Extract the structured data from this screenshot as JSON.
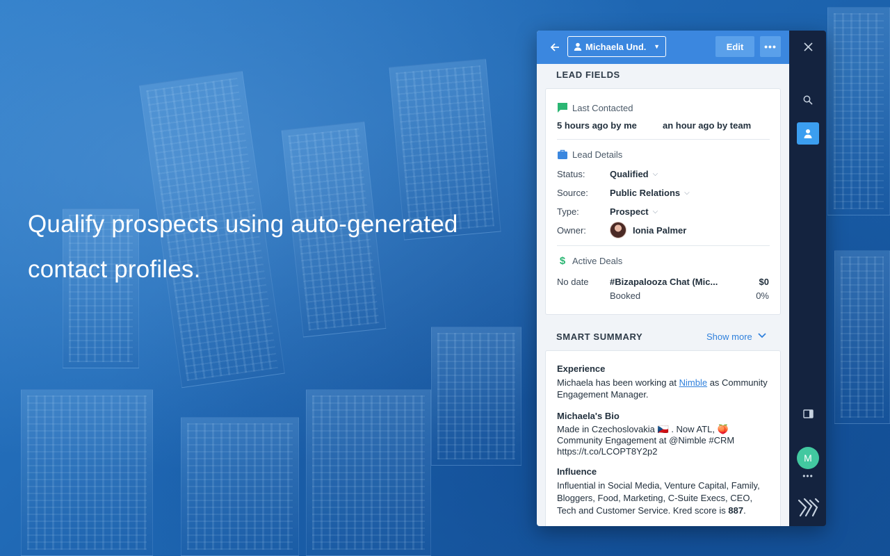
{
  "headline": "Qualify prospects using auto-generated contact profiles.",
  "topbar": {
    "back_icon": "arrow-left-icon",
    "contact_name": "Michaela Und...",
    "edit_label": "Edit",
    "more_label": "•••"
  },
  "lead_fields": {
    "title": "LEAD FIELDS",
    "last_contacted": {
      "heading": "Last Contacted",
      "by_me": "5 hours ago by me",
      "by_team": "an hour ago by team",
      "icon_color": "#2bb673"
    },
    "lead_details": {
      "heading": "Lead Details",
      "icon_color": "#3b87df",
      "rows": [
        {
          "label": "Status:",
          "value": "Qualified"
        },
        {
          "label": "Source:",
          "value": "Public Relations"
        },
        {
          "label": "Type:",
          "value": "Prospect"
        },
        {
          "label": "Owner:",
          "value": "Ionia Palmer"
        }
      ]
    },
    "active_deals": {
      "heading": "Active Deals",
      "date": "No date",
      "deal_name": "#Bizapalooza Chat (Mic...",
      "amount": "$0",
      "stage": "Booked",
      "probability": "0%"
    }
  },
  "smart_summary": {
    "title": "SMART SUMMARY",
    "show_more": "Show more",
    "experience_heading": "Experience",
    "experience_pre": "Michaela has been working at ",
    "experience_link": "Nimble",
    "experience_post": " as Community Engagement Manager.",
    "bio_heading": "Michaela's Bio",
    "bio_line1": "Made in Czechoslovakia 🇨🇿 . Now ATL, 🍑",
    "bio_line2": "Community Engagement at @Nimble #CRM",
    "bio_line3": "https://t.co/LCOPT8Y2p2",
    "influence_heading": "Influence",
    "influence_text": "Influential in Social Media, Venture Capital, Family, Bloggers, Food, Marketing, C-Suite Execs, CEO, Tech and Customer Service. Kred score is ",
    "kred_score": "887",
    "influence_end": "."
  },
  "rail": {
    "close_icon": "close-icon",
    "search_icon": "search-icon",
    "contact_icon": "contact-icon",
    "panel_icon": "sidebar-toggle-icon",
    "user_initial": "M",
    "dots": "•••"
  },
  "colors": {
    "topbar": "#3b87df",
    "rail": "#14233f",
    "accent": "#2f80dc",
    "user_avatar": "#42c8a0"
  }
}
